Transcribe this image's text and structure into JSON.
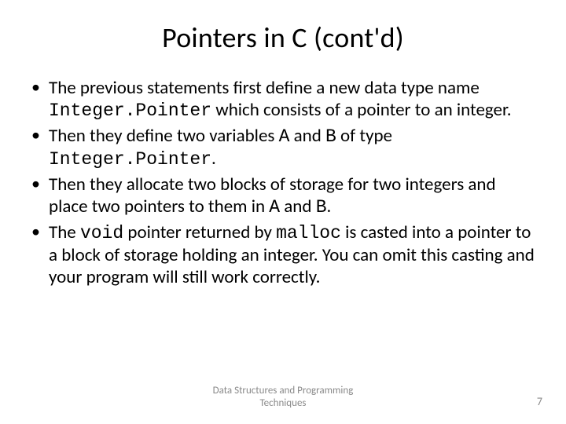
{
  "title": "Pointers in C (cont'd)",
  "bullets": [
    {
      "segments": [
        {
          "text": "The previous statements first define a new data type name ",
          "mono": false
        },
        {
          "text": "Integer.Pointer",
          "mono": true
        },
        {
          "text": " which consists of a pointer to an integer.",
          "mono": false
        }
      ]
    },
    {
      "segments": [
        {
          "text": "Then they define two variables ",
          "mono": false
        },
        {
          "text": "A",
          "mono": true
        },
        {
          "text": " and ",
          "mono": false
        },
        {
          "text": "B",
          "mono": true
        },
        {
          "text": " of type ",
          "mono": false
        },
        {
          "text": "Integer.Pointer",
          "mono": true
        },
        {
          "text": ".",
          "mono": false
        }
      ]
    },
    {
      "segments": [
        {
          "text": "Then they allocate two blocks of storage for two integers and place two pointers to them in ",
          "mono": false
        },
        {
          "text": "A",
          "mono": true
        },
        {
          "text": " and ",
          "mono": false
        },
        {
          "text": "B",
          "mono": true
        },
        {
          "text": ".",
          "mono": false
        }
      ]
    },
    {
      "segments": [
        {
          "text": "The ",
          "mono": false
        },
        {
          "text": "void",
          "mono": true
        },
        {
          "text": " pointer returned by ",
          "mono": false
        },
        {
          "text": "malloc",
          "mono": true
        },
        {
          "text": " is casted into a pointer to a block of storage holding an integer. You can omit this casting and your program will still work correctly.",
          "mono": false
        }
      ]
    }
  ],
  "footer": {
    "center_line1": "Data Structures and Programming",
    "center_line2": "Techniques",
    "page_number": "7"
  }
}
